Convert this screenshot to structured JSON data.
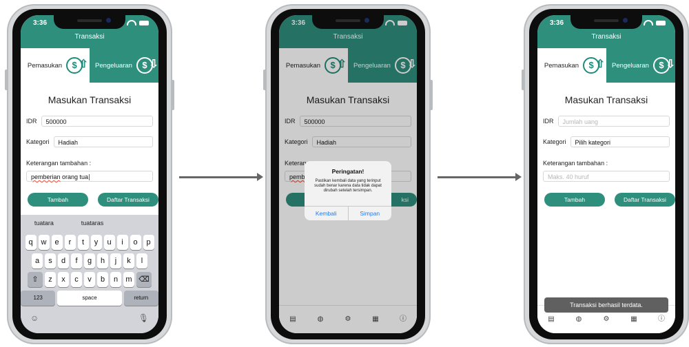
{
  "status": {
    "time": "3:36"
  },
  "nav_title": "Transaksi",
  "tabs": {
    "income": "Pemasukan",
    "expense": "Pengeluaran"
  },
  "form": {
    "title": "Masukan Transaksi",
    "currency": "IDR",
    "category_label": "Kategori",
    "note_label": "Keterangan tambahan :",
    "add_button": "Tambah",
    "list_button": "Daftar Transaksi"
  },
  "screen1": {
    "amount": "500000",
    "category": "Hadiah",
    "note_word1": "pemberian",
    "note_rest": " orang tua"
  },
  "keyboard": {
    "suggestions": [
      "tuatara",
      "tuataras"
    ],
    "row1": [
      "q",
      "w",
      "e",
      "r",
      "t",
      "y",
      "u",
      "i",
      "o",
      "p"
    ],
    "row2": [
      "a",
      "s",
      "d",
      "f",
      "g",
      "h",
      "j",
      "k",
      "l"
    ],
    "row3": [
      "z",
      "x",
      "c",
      "v",
      "b",
      "n",
      "m"
    ],
    "num": "123",
    "space": "space",
    "return": "return"
  },
  "screen2": {
    "amount": "500000",
    "category": "Hadiah",
    "note_partial": "Keteran",
    "note_value_partial": "pemb",
    "list_partial": "ksi",
    "alert_title": "Peringatan!",
    "alert_message": "Pastikan kembali data yang terinput sudah benar karena data tidak dapat dirubah setelah tersimpan.",
    "back_button": "Kembali",
    "save_button": "Simpan"
  },
  "screen3": {
    "amount_placeholder": "Jumlah uang",
    "category_placeholder": "Pilih kategori",
    "note_placeholder": "Maks. 40 huruf",
    "toast": "Transaksi berhasil terdata."
  },
  "colors": {
    "primary": "#2f8f7d",
    "link": "#1d7bf2"
  }
}
